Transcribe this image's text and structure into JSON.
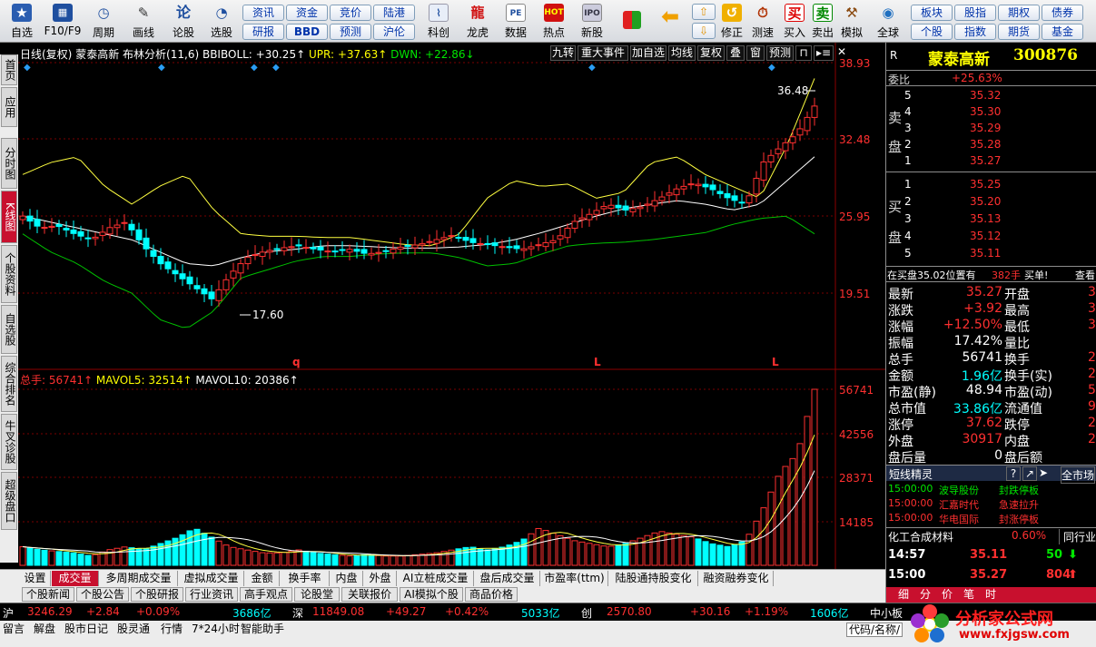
{
  "toolbar": {
    "buttons": [
      "自选",
      "F10/F9",
      "周期",
      "画线",
      "论股",
      "选股",
      "科创",
      "龙虎",
      "数据",
      "热点",
      "新股",
      "修正",
      "测速",
      "买入",
      "卖出",
      "模拟",
      "全球"
    ],
    "grid_left": [
      "资讯",
      "研报",
      "资金",
      "BBD",
      "竞价",
      "预测",
      "陆港",
      "沪伦"
    ],
    "grid_right": [
      "板块",
      "个股",
      "股指",
      "指数",
      "期权",
      "期货",
      "债券",
      "基金"
    ]
  },
  "sidebar": [
    "首页",
    "应用",
    "分时图",
    "K线图",
    "个股资料",
    "自选股",
    "综合排名",
    "牛叉诊股",
    "超级盘口"
  ],
  "chart": {
    "header": {
      "period": "日线(复权)",
      "name": "蒙泰高新",
      "indicator": "布林分析(11,6)",
      "bbiboll": "BBIBOLL: +30.25↑",
      "upr": "UPR: +37.63↑",
      "dwn": "DWN: +22.86↓"
    },
    "top_buttons": [
      "九转",
      "重大事件",
      "加自选",
      "均线",
      "复权",
      "叠",
      "窗",
      "预测"
    ],
    "price_ticks": [
      "38.93",
      "32.48",
      "25.95",
      "19.51"
    ],
    "high_label": "36.48",
    "low_label": "17.60",
    "markers": [
      "q",
      "L",
      "L"
    ],
    "vol_header": {
      "total": "总手: 56741↑",
      "ma5": "MAVOL5: 32514↑",
      "ma10": "MAVOL10: 20386↑"
    },
    "vol_ticks": [
      "56741",
      "42556",
      "28371",
      "14185"
    ]
  },
  "right": {
    "code_label": "R",
    "title": "蒙泰高新",
    "code": "300876",
    "weibi_label": "委比",
    "weibi": "+25.63%",
    "sell_label": "卖",
    "buy_label": "买",
    "pan_label": "盘",
    "sell": [
      [
        "5",
        "35.32"
      ],
      [
        "4",
        "35.30"
      ],
      [
        "3",
        "35.29"
      ],
      [
        "2",
        "35.28"
      ],
      [
        "1",
        "35.27"
      ]
    ],
    "buy": [
      [
        "1",
        "35.25"
      ],
      [
        "2",
        "35.20"
      ],
      [
        "3",
        "35.13"
      ],
      [
        "4",
        "35.12"
      ],
      [
        "5",
        "35.11"
      ]
    ],
    "notice": "在买盘35.02位置有",
    "notice_vol": "382手",
    "notice_act": "买单!",
    "notice_btn": "查看",
    "stats": [
      [
        "最新",
        "35.27",
        "开盘",
        "3"
      ],
      [
        "涨跌",
        "+3.92",
        "最高",
        "3"
      ],
      [
        "涨幅",
        "+12.50%",
        "最低",
        "3"
      ],
      [
        "振幅",
        "17.42%",
        "量比",
        ""
      ],
      [
        "总手",
        "56741",
        "换手",
        "20"
      ],
      [
        "金额",
        "1.96亿",
        "换手(实)",
        "20"
      ],
      [
        "市盈(静)",
        "48.94",
        "市盈(动)",
        "5"
      ],
      [
        "总市值",
        "33.86亿",
        "流通值",
        "9."
      ],
      [
        "涨停",
        "37.62",
        "跌停",
        "2"
      ],
      [
        "外盘",
        "30917",
        "内盘",
        "2!"
      ],
      [
        "盘后量",
        "0",
        "盘后额",
        ""
      ]
    ],
    "jingling": {
      "title": "短线精灵",
      "btn": "全市场",
      "items": [
        [
          "15:00:00",
          "波导股份",
          "封跌停板"
        ],
        [
          "15:00:00",
          "汇嘉时代",
          "急速拉升"
        ],
        [
          "15:00:00",
          "华电国际",
          "封涨停板"
        ]
      ]
    },
    "industry": "化工合成材料",
    "industry_pct": "0.60%",
    "industry_btn": "同行业",
    "ticks": [
      [
        "14:57",
        "35.11",
        "50"
      ],
      [
        "15:00",
        "35.27",
        "804"
      ]
    ],
    "tabs": [
      "细",
      "分",
      "价",
      "笔",
      "时"
    ]
  },
  "bottom_tabs": [
    "设置",
    "成交量",
    "多周期成交量",
    "虚拟成交量",
    "金额",
    "换手率",
    "内盘",
    "外盘",
    "AI立桩成交量",
    "盘后成交量",
    "市盈率(ttm)",
    "陆股通持股变化",
    "融资融券变化"
  ],
  "info_tabs": [
    "个股新闻",
    "个股公告",
    "个股研报",
    "行业资讯",
    "高手观点",
    "论股堂",
    "关联报价",
    "AI模拟个股",
    "商品价格"
  ],
  "index": {
    "sh_label": "沪",
    "sh": "3246.29",
    "sh_chg": "+2.84",
    "sh_pct": "+0.09%",
    "sh_amt": "3686亿",
    "sz_label": "深",
    "sz": "11849.08",
    "sz_chg": "+49.27",
    "sz_pct": "+0.42%",
    "sz_amt": "5033亿",
    "cy_label": "创",
    "cy": "2570.80",
    "cy_chg": "+30.16",
    "cy_pct": "+1.19%",
    "cy_amt": "1606亿",
    "zx": "中小板"
  },
  "status": [
    "留言",
    "解盘",
    "股市日记",
    "股灵通",
    "行情",
    "7*24小时",
    "智能助手"
  ],
  "status_right": "代码/名称/",
  "watermark": {
    "text": "分析家公式网",
    "url": "www.fxjgsw.com"
  }
}
